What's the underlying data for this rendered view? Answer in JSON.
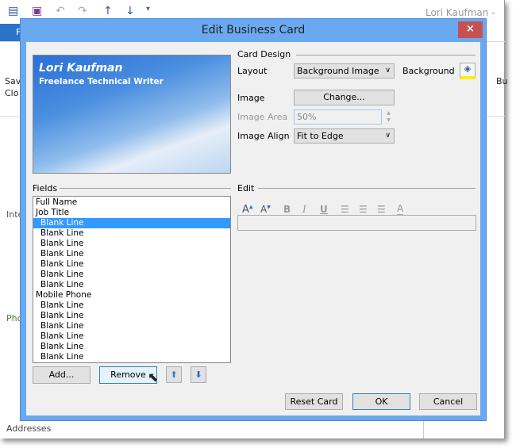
{
  "app": {
    "window_title": "Lori Kaufman - Co",
    "ribbon_tab": "F",
    "left_button": [
      "Sav",
      "Clo"
    ],
    "right_button": "Bu",
    "field_labels": [
      "Inte",
      "Pho",
      "Addresses"
    ]
  },
  "dialog": {
    "title": "Edit Business Card",
    "close_label": "×",
    "card": {
      "name": "Lori Kaufman",
      "job_title": "Freelance Technical Writer"
    },
    "fields": {
      "label": "Fields",
      "items": [
        {
          "label": "Full Name",
          "indent": false
        },
        {
          "label": "Job Title",
          "indent": false
        },
        {
          "label": "Blank Line",
          "indent": true,
          "selected": true
        },
        {
          "label": "Blank Line",
          "indent": true
        },
        {
          "label": "Blank Line",
          "indent": true
        },
        {
          "label": "Blank Line",
          "indent": true
        },
        {
          "label": "Blank Line",
          "indent": true
        },
        {
          "label": "Blank Line",
          "indent": true
        },
        {
          "label": "Blank Line",
          "indent": true
        },
        {
          "label": "Mobile Phone",
          "indent": false
        },
        {
          "label": "Blank Line",
          "indent": true
        },
        {
          "label": "Blank Line",
          "indent": true
        },
        {
          "label": "Blank Line",
          "indent": true
        },
        {
          "label": "Blank Line",
          "indent": true
        },
        {
          "label": "Blank Line",
          "indent": true
        },
        {
          "label": "Blank Line",
          "indent": true
        }
      ],
      "add": "Add...",
      "remove": "Remove"
    },
    "design": {
      "label": "Card Design",
      "layout_label": "Layout",
      "layout_value": "Background Image",
      "background_label": "Background",
      "image_label": "Image",
      "change": "Change...",
      "area_label": "Image Area",
      "area_value": "50%",
      "align_label": "Image Align",
      "align_value": "Fit to Edge"
    },
    "edit": {
      "label": "Edit",
      "value": ""
    },
    "footer": {
      "reset": "Reset Card",
      "ok": "OK",
      "cancel": "Cancel"
    }
  },
  "colors": {
    "title_bar": "#6aa8f0",
    "close": "#c75050",
    "selection": "#3399ff"
  }
}
